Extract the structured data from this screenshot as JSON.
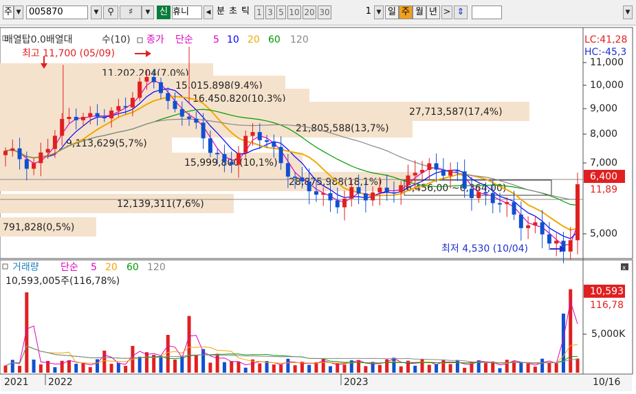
{
  "toolbar": {
    "market_select": "주",
    "code_input": "005870",
    "new_badge": "신",
    "stock_name": "휴니",
    "periods": [
      "분",
      "초",
      "틱"
    ],
    "interval_buttons": [
      "1",
      "3",
      "5",
      "10",
      "20",
      "30"
    ],
    "unit_value": "1",
    "timeframes": [
      "일",
      "주",
      "월",
      "년"
    ],
    "selected_timeframe": "주"
  },
  "price_panel": {
    "legend_overlap": "배열탑0.0배열대",
    "legend_ma_count": "수(10)",
    "legend_close": "종가",
    "legend_simple": "단순",
    "ma_periods": [
      "5",
      "10",
      "20",
      "60",
      "120"
    ],
    "ma_colors": [
      "#e000c0",
      "#0000ff",
      "#f0a800",
      "#009900",
      "#888888"
    ],
    "lc_label": "LC:41,28",
    "hc_label": "HC:-45,3",
    "high_label": "최고 11,700 (05/09)",
    "low_label": "최저 4,530 (10/04)",
    "current_price": "6,400",
    "pct_label": "11,89",
    "y_axis_ticks": [
      "11,000",
      "10,000",
      "9,000",
      "8,000",
      "7,000",
      "5,000"
    ],
    "volume_profile": [
      "11,202,204(7,0%)",
      "15,015,898(9,4%)",
      "16,450,820(10,3%)",
      "27,713,587(17,4%)",
      "21,805,588(13,7%)",
      "9,113,629(5,7%)",
      "15,999,800(10,1%)",
      "28,875,988(18,1%)",
      "12,139,311(7,6%)",
      "791,828(0,5%)"
    ],
    "range_box": "6,456,00 ~6,364,00)"
  },
  "volume_panel": {
    "legend_name": "거래량",
    "legend_simple": "단순",
    "ma_periods": [
      "5",
      "20",
      "60",
      "120"
    ],
    "value_label": "10,593,005주(116,78%)",
    "current_volume": "10,593",
    "current_pct": "116,78",
    "y_axis_ticks": [
      "5,000K"
    ]
  },
  "x_axis": {
    "labels": [
      "2021",
      "2022",
      "2023"
    ],
    "date_label": "10/16"
  },
  "chart_data": [
    {
      "type": "candlestick",
      "title": "",
      "x_unit": "week",
      "ylim": [
        4400,
        11600
      ],
      "high": 11700,
      "low": 4530,
      "last": 6400,
      "close_path": [
        7300,
        7200,
        7000,
        7600,
        8500,
        8900,
        8600,
        8700,
        9100,
        10000,
        10300,
        9200,
        9000,
        8200,
        7400,
        7000,
        7500,
        8000,
        7700,
        7000,
        6200,
        6300,
        6000,
        5900,
        6100,
        6200,
        6300,
        6100,
        7000,
        6900,
        6700,
        6500,
        6200,
        6000,
        5700,
        5500,
        5200,
        4800,
        4530,
        6400
      ]
    },
    {
      "type": "bar",
      "title": "",
      "x_unit": "week",
      "ylim": [
        0,
        11000
      ],
      "unit": "K",
      "last": 10593
    }
  ]
}
